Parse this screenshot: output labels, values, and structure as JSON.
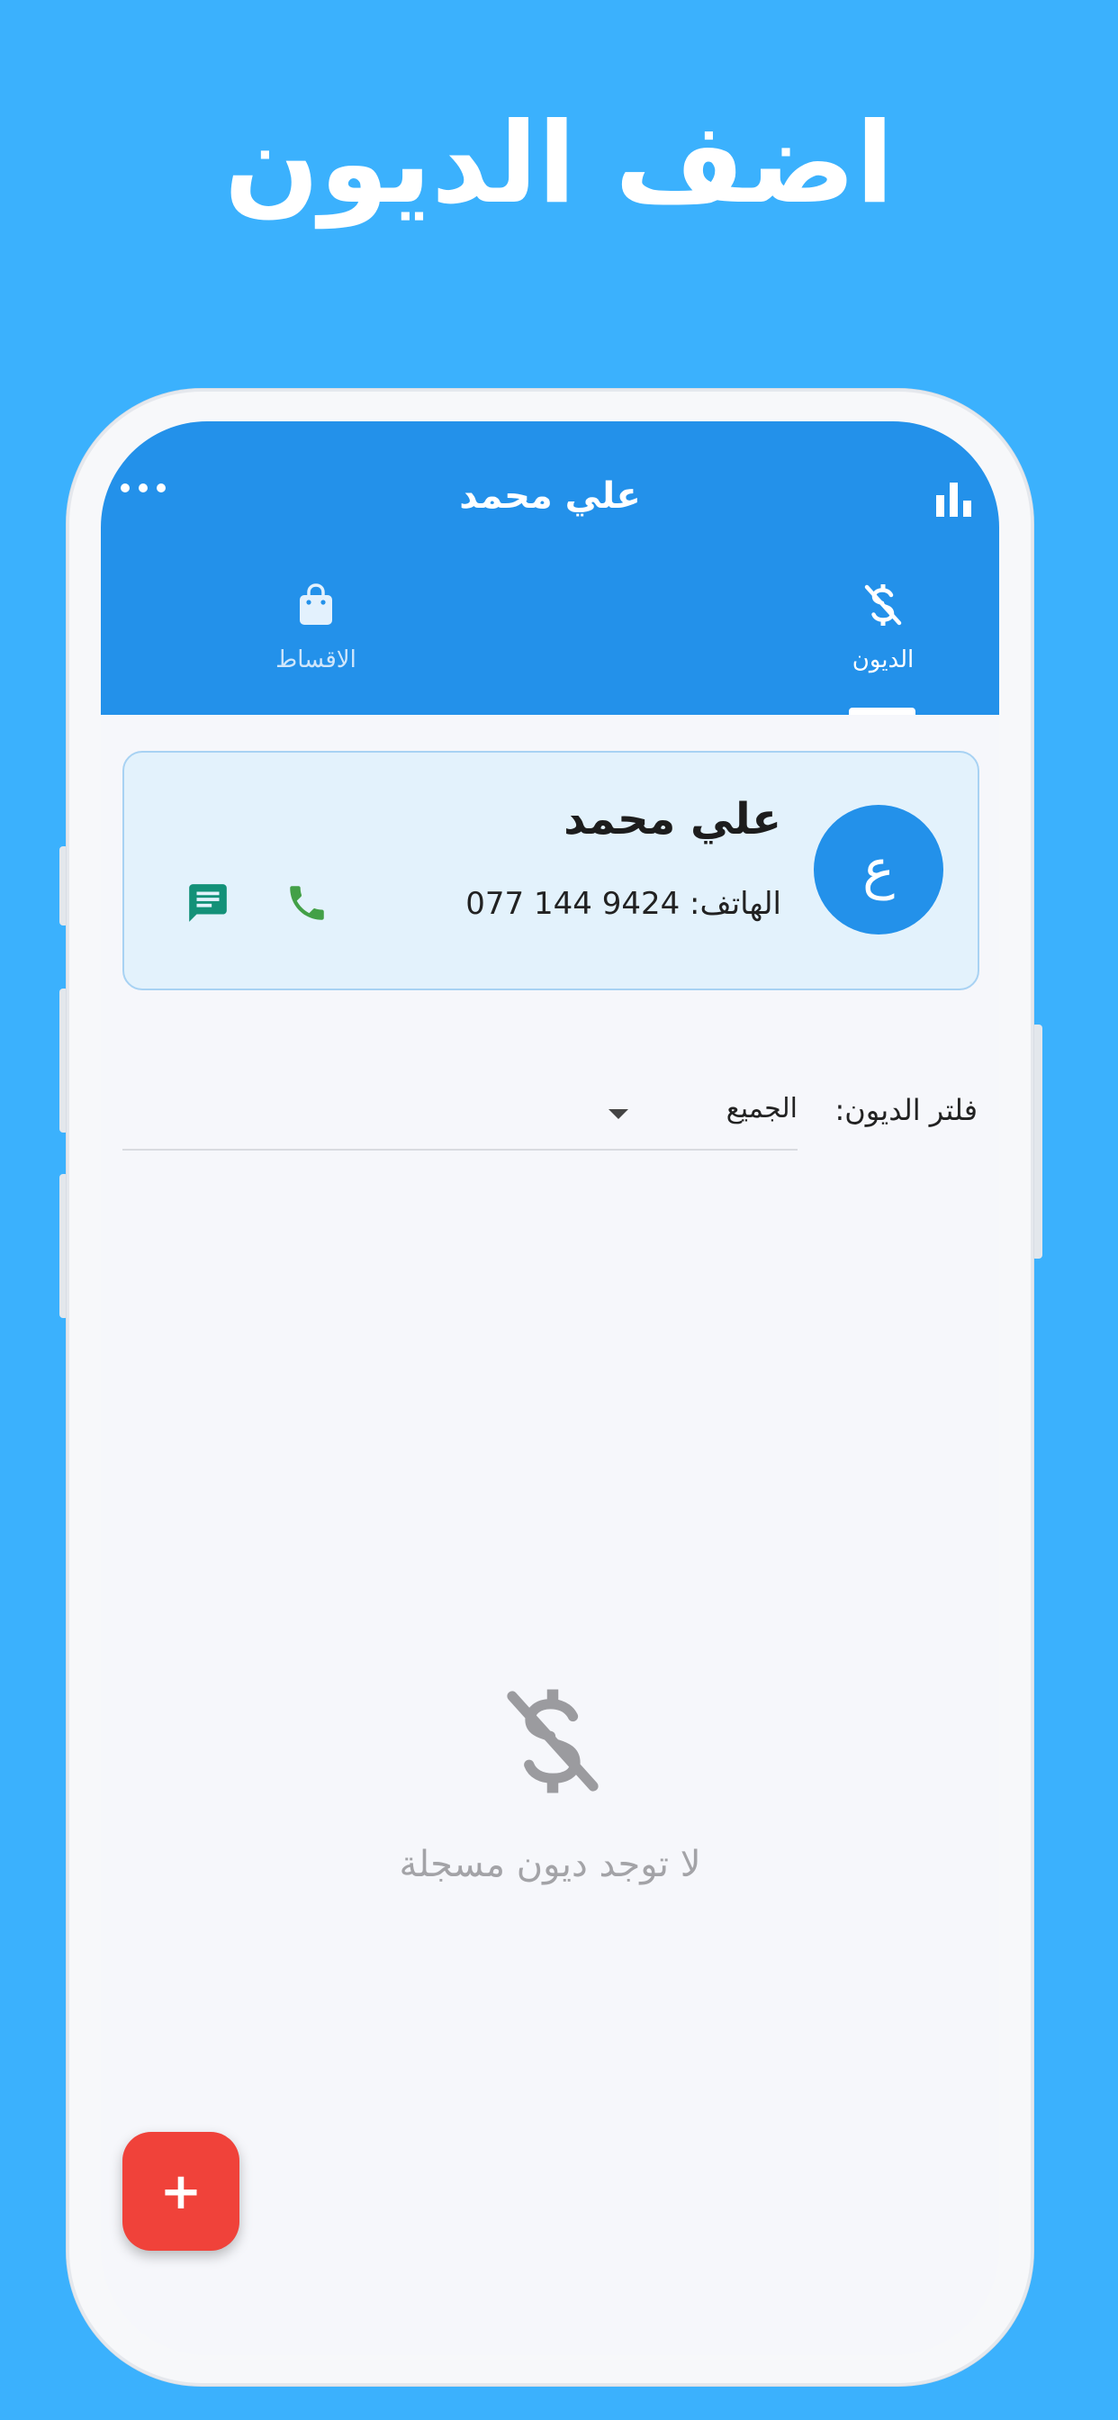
{
  "headline": "اضف الديون",
  "appbar": {
    "title": "علي محمد",
    "tabs": [
      {
        "label": "الديون",
        "icon": "money-off-icon",
        "selected": true
      },
      {
        "label": "الاقساط",
        "icon": "shopping-bag-icon",
        "selected": false
      }
    ]
  },
  "contact": {
    "avatar_letter": "ع",
    "name": "علي محمد",
    "phone_label": "الهاتف:",
    "phone_number": "077 144 9424"
  },
  "filter": {
    "label": "فلتر الديون:",
    "selected": "الجميع"
  },
  "empty_state": {
    "icon": "money-off-icon",
    "message": "لا توجد ديون مسجلة"
  },
  "fab": {
    "label": "+"
  },
  "colors": {
    "background": "#3bb1fd",
    "appbar": "#2391ea",
    "fab": "#f0423a",
    "message_icon": "#139178",
    "call_icon": "#43a047"
  }
}
